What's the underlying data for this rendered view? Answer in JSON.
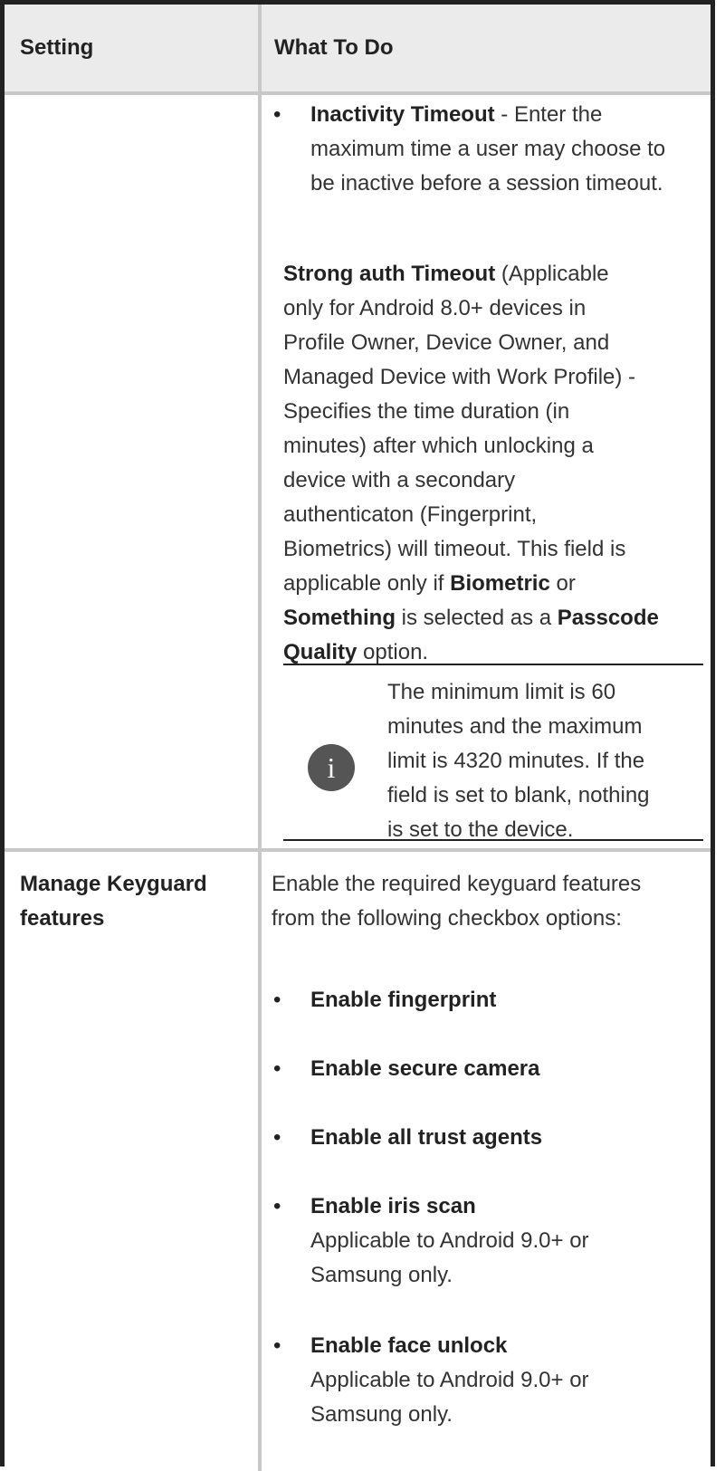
{
  "header": {
    "col_setting": "Setting",
    "col_what": "What To Do"
  },
  "row1": {
    "inactivity": {
      "label": "Inactivity Timeout",
      "text_l1": " - Enter the",
      "text_l2": "maximum time a user may choose to",
      "text_l3": "be inactive before a session timeout."
    },
    "strong_auth": {
      "label": "Strong auth Timeout",
      "l1_rest": " (Applicable",
      "l2": "only for Android 8.0+ devices in",
      "l3": "Profile Owner, Device Owner, and",
      "l4": "Managed Device with Work Profile) -",
      "l5": "Specifies the time duration (in",
      "l6": "minutes) after which unlocking a",
      "l7": "device with a secondary",
      "l8": "authenticaton (Fingerprint,",
      "l9": "Biometrics) will timeout. This field is",
      "l10_pre": "applicable only if ",
      "l10_bold": "Biometric",
      "l10_post": " or",
      "l11_bold1": "Something",
      "l11_mid": " is selected as a ",
      "l11_bold2": "Passcode",
      "l12_bold": "Quality",
      "l12_post": " option."
    },
    "note": {
      "icon": "info-icon",
      "l1": "The minimum limit is 60",
      "l2": "minutes and the maximum",
      "l3": "limit is 4320 minutes. If the",
      "l4": "field is set to blank, nothing",
      "l5": "is set to the device."
    }
  },
  "row2": {
    "setting_l1": "Manage Keyguard",
    "setting_l2": "features",
    "intro_l1": "Enable the required keyguard features",
    "intro_l2": "from the following checkbox options:",
    "items": [
      {
        "label": "Enable fingerprint"
      },
      {
        "label": "Enable secure camera"
      },
      {
        "label": "Enable all trust agents"
      },
      {
        "label": "Enable iris scan",
        "desc_l1": "Applicable to Android 9.0+ or",
        "desc_l2": "Samsung only."
      },
      {
        "label": "Enable face unlock",
        "desc_l1": "Applicable to Android 9.0+ or",
        "desc_l2": "Samsung only."
      }
    ]
  },
  "colors": {
    "header_bg": "#ebebeb",
    "border": "#c8c8c8",
    "outer_border": "#222222",
    "icon_bg": "#555555"
  }
}
